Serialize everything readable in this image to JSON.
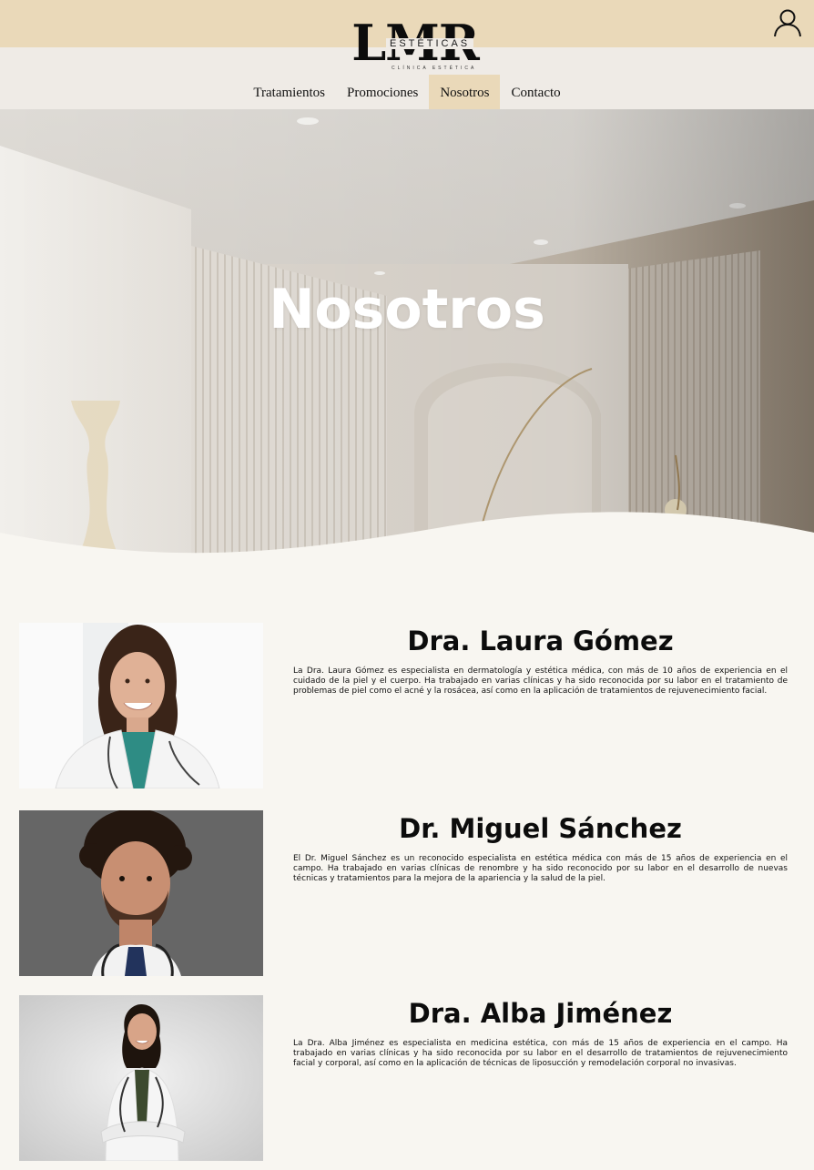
{
  "header": {
    "logo_text": "LMR",
    "logo_subtitle": "ESTÉTICAS",
    "logo_tagline": "CLÍNICA ESTÉTICA",
    "user_icon": "user-icon",
    "colors": {
      "topbar": "#ead9b9",
      "navbar": "#efebe6",
      "active_tab": "#ead9b9"
    }
  },
  "nav": {
    "items": [
      {
        "label": "Tratamientos"
      },
      {
        "label": "Promociones"
      },
      {
        "label": "Nosotros",
        "active": true
      },
      {
        "label": "Contacto"
      }
    ]
  },
  "hero": {
    "title": "Nosotros"
  },
  "doctors": [
    {
      "name": "Dra. Laura Gómez",
      "bio": "La Dra. Laura Gómez es especialista en dermatología y estética médica, con más de 10 años de experiencia en el cuidado de la piel y el cuerpo. Ha trabajado en varias clínicas y ha sido reconocida por su labor en el tratamiento de problemas de piel como el acné y la rosácea, así como en la aplicación de tratamientos de rejuvenecimiento facial."
    },
    {
      "name": "Dr. Miguel Sánchez",
      "bio": "El Dr. Miguel Sánchez es un reconocido especialista en estética médica con más de 15 años de experiencia en el campo. Ha trabajado en varias clínicas de renombre y ha sido reconocido por su labor en el desarrollo de nuevas técnicas y tratamientos para la mejora de la apariencia y la salud de la piel."
    },
    {
      "name": "Dra. Alba Jiménez",
      "bio": "La Dra. Alba Jiménez es especialista en medicina estética, con más de 15 años de experiencia en el campo. Ha trabajado en varias clínicas y ha sido reconocida por su labor en el desarrollo de tratamientos de rejuvenecimiento facial y corporal, así como en la aplicación de técnicas de liposucción y remodelación corporal no invasivas."
    }
  ]
}
